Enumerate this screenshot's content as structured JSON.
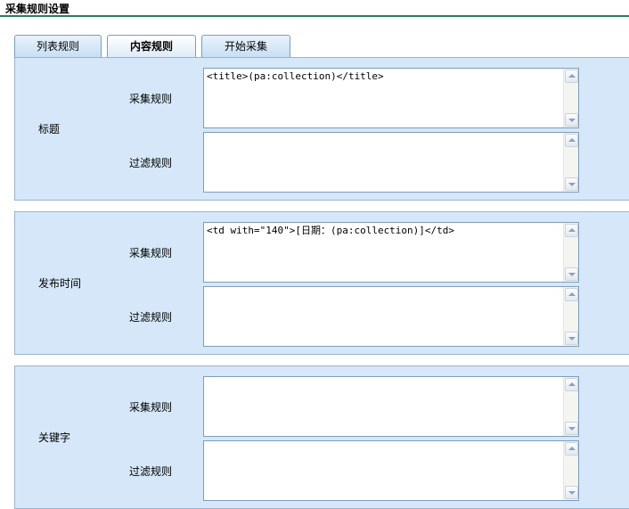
{
  "header": {
    "title": "采集规则设置"
  },
  "tabs": [
    {
      "label": "列表规则",
      "active": false
    },
    {
      "label": "内容规则",
      "active": true
    },
    {
      "label": "开始采集",
      "active": false
    }
  ],
  "sections": [
    {
      "field": "标题",
      "collect_label": "采集规则",
      "collect_value": "<title>(pa:collection)</title>",
      "filter_label": "过滤规则",
      "filter_value": ""
    },
    {
      "field": "发布时间",
      "collect_label": "采集规则",
      "collect_value": "<td with=\"140\">[日期：(pa:collection)]</td>",
      "filter_label": "过滤规则",
      "filter_value": ""
    },
    {
      "field": "关键字",
      "collect_label": "采集规则",
      "collect_value": "",
      "filter_label": "过滤规则",
      "filter_value": ""
    }
  ],
  "icons": {
    "scroll_up": "scroll-up-arrow-icon",
    "scroll_down": "scroll-down-arrow-icon"
  },
  "colors": {
    "header_rule": "#2f7d55",
    "panel_bg": "#d5e7f8",
    "panel_border": "#9ab3ce"
  }
}
